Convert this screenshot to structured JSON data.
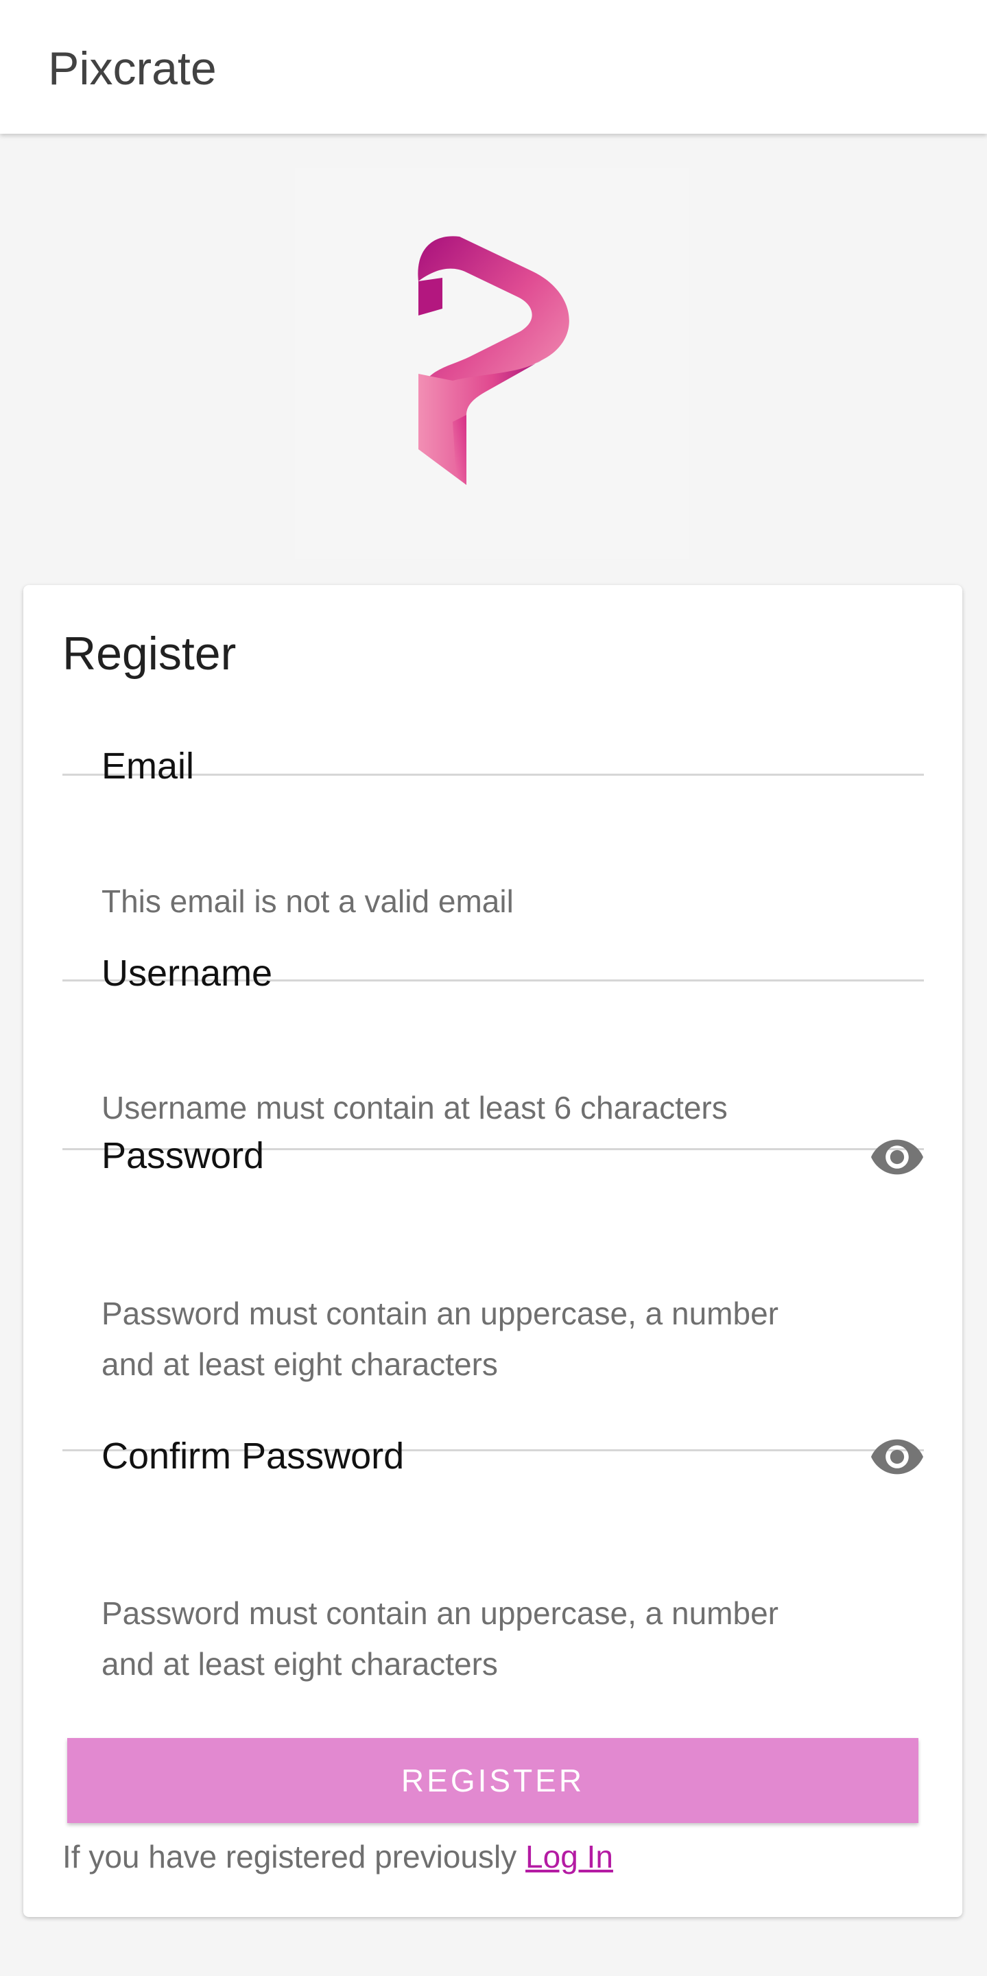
{
  "app_bar": {
    "title": "Pixcrate"
  },
  "logo": {
    "icon": "pixcrate-logo",
    "colors": [
      "#b0137f",
      "#e25297",
      "#f28fb4"
    ]
  },
  "register_form": {
    "title": "Register",
    "email": {
      "label": "Email",
      "value": "",
      "helper": "This email is not a valid email"
    },
    "username": {
      "label": "Username",
      "value": "",
      "helper": "Username must contain at least 6 characters"
    },
    "password": {
      "label": "Password",
      "value": "",
      "helper_line1": "Password must contain an uppercase, a number",
      "helper_line2": "and at least eight characters",
      "toggle_icon": "eye-icon"
    },
    "confirm_password": {
      "label": "Confirm Password",
      "value": "",
      "helper_line1": "Password must contain an uppercase, a number",
      "helper_line2": "and at least eight characters",
      "toggle_icon": "eye-icon"
    },
    "submit_label": "REGISTER",
    "footer_text": "If you have registered previously ",
    "login_link": "Log In"
  },
  "colors": {
    "accent": "#e289d0",
    "link": "#b41ba3",
    "background": "#f5f5f5"
  }
}
